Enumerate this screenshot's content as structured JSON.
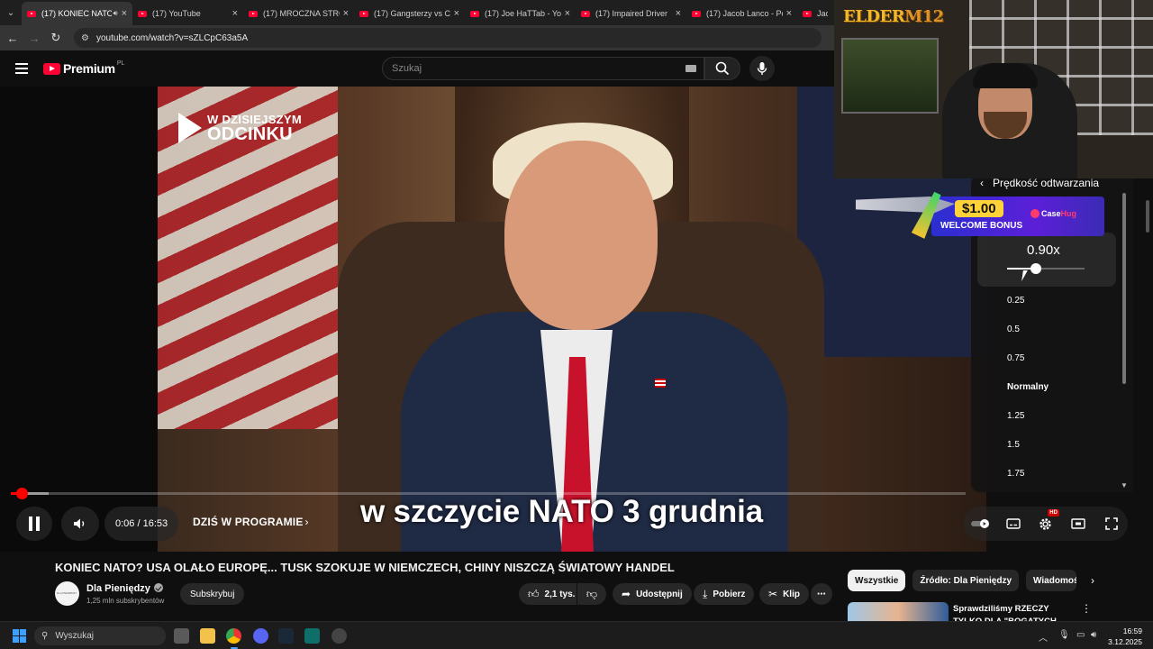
{
  "browser": {
    "tabs": [
      {
        "title": "(17) KONIEC NATO",
        "active": true,
        "audio": true
      },
      {
        "title": "(17) YouTube"
      },
      {
        "title": "(17) MROCZNA STRO"
      },
      {
        "title": "(17) Gangsterzy vs Ch"
      },
      {
        "title": "(17) Joe HaTTab - You"
      },
      {
        "title": "(17) Impaired Driver"
      },
      {
        "title": "(17) Jacob Lanco - Po"
      },
      {
        "title": "Jaco"
      }
    ],
    "url": "youtube.com/watch?v=sZLCpC63a5A"
  },
  "youtube": {
    "logo_text": "Premium",
    "region": "PL",
    "search_placeholder": "Szukaj"
  },
  "video": {
    "episode_badge_line1": "W DZISIEJSZYM",
    "episode_badge_line2": "ODCINKU",
    "subtitle": "w szczycie NATO 3 grudnia",
    "time": "0:06 / 16:53",
    "chapter": "DZIŚ W PROGRAMIE",
    "progress_fraction": 0.006,
    "buffered_fraction": 0.04,
    "hd_badge": "HD"
  },
  "speed_menu": {
    "title": "Prędkość odtwarzania",
    "current": "0.90x",
    "current_value": 0.9,
    "range": [
      0.25,
      2
    ],
    "options": [
      "0.25",
      "0.5",
      "0.75",
      "Normalny",
      "1.25",
      "1.5",
      "1.75"
    ]
  },
  "ad": {
    "amount": "$1.00",
    "line": "WELCOME BONUS",
    "brand_a": "Case",
    "brand_b": "Hug"
  },
  "stream_overlay": {
    "logo_a": "ELDER",
    "logo_b": "M12"
  },
  "details": {
    "title": "KONIEC NATO? USA OLAŁO EUROPĘ... TUSK SZOKUJE W NIEMCZECH, CHINY NISZCZĄ ŚWIATOWY HANDEL",
    "channel": "Dla Pieniędzy",
    "subscribers": "1,25 mln subskrybentów",
    "subscribe": "Subskrybuj",
    "likes": "2,1 tys.",
    "share": "Udostępnij",
    "download": "Pobierz",
    "clip": "Klip"
  },
  "related": {
    "chips": [
      "Wszystkie",
      "Źródło: Dla Pieniędzy",
      "Wiadomości"
    ],
    "first_title": "Sprawdziliśmy RZECZY TYLKO DLA \"BOGATYCH LUDZI\""
  },
  "taskbar": {
    "search": "Wyszukaj",
    "time": "16:59",
    "date": "3.12.2025"
  },
  "colors": {
    "accent_red": "#ff0033",
    "taskbar_accent": "#4aa3ff",
    "ad_gold": "#ffd23a"
  }
}
